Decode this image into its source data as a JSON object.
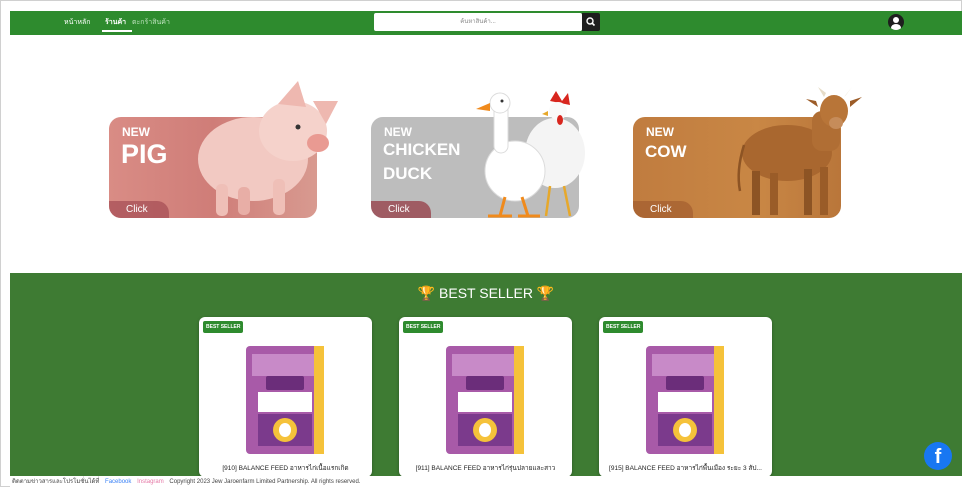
{
  "nav": {
    "home_label": "หน้าหลัก",
    "shop_label": "ร้านค้า",
    "order_label": "ตะกร้าสินค้า",
    "search_placeholder": "ค้นหาสินค้า...",
    "search_icon": "search-icon",
    "user_icon": "user-circle-icon"
  },
  "hero": {
    "cards": [
      {
        "tag": "NEW",
        "lines": [
          "PIG"
        ],
        "click_label": "Click"
      },
      {
        "tag": "NEW",
        "lines": [
          "CHICKEN",
          "DUCK"
        ],
        "click_label": "Click"
      },
      {
        "tag": "NEW",
        "lines": [
          "COW"
        ],
        "click_label": "Click"
      }
    ]
  },
  "bestseller": {
    "title": "BEST SELLER",
    "trophy_icon": "trophy-icon",
    "products": [
      {
        "badge": "BEST SELLER",
        "name": "[910] BALANCE FEED อาหารไก่เนื้อแรกเกิด"
      },
      {
        "badge": "BEST SELLER",
        "name": "[911] BALANCE FEED อาหารไก่รุ่นปลายและสาว"
      },
      {
        "badge": "BEST SELLER",
        "name": "[915] BALANCE FEED อาหารไก่พื้นเมือง ระยะ 3 สัป..."
      }
    ]
  },
  "footer": {
    "contact": "ติดตามข่าวสารและโปรโมชั่นได้ที่",
    "facebook": "Facebook",
    "instagram": "Instagram",
    "copyright": "Copyright 2023 Jew Jaroenfarm Limited Partnership. All rights reserved."
  },
  "floating": {
    "facebook_icon": "facebook-icon"
  },
  "colors": {
    "nav_green": "#2e8b2e",
    "section_green": "#3e7b33",
    "badge_green": "#2e8b2e",
    "facebook_blue": "#1877f2"
  }
}
